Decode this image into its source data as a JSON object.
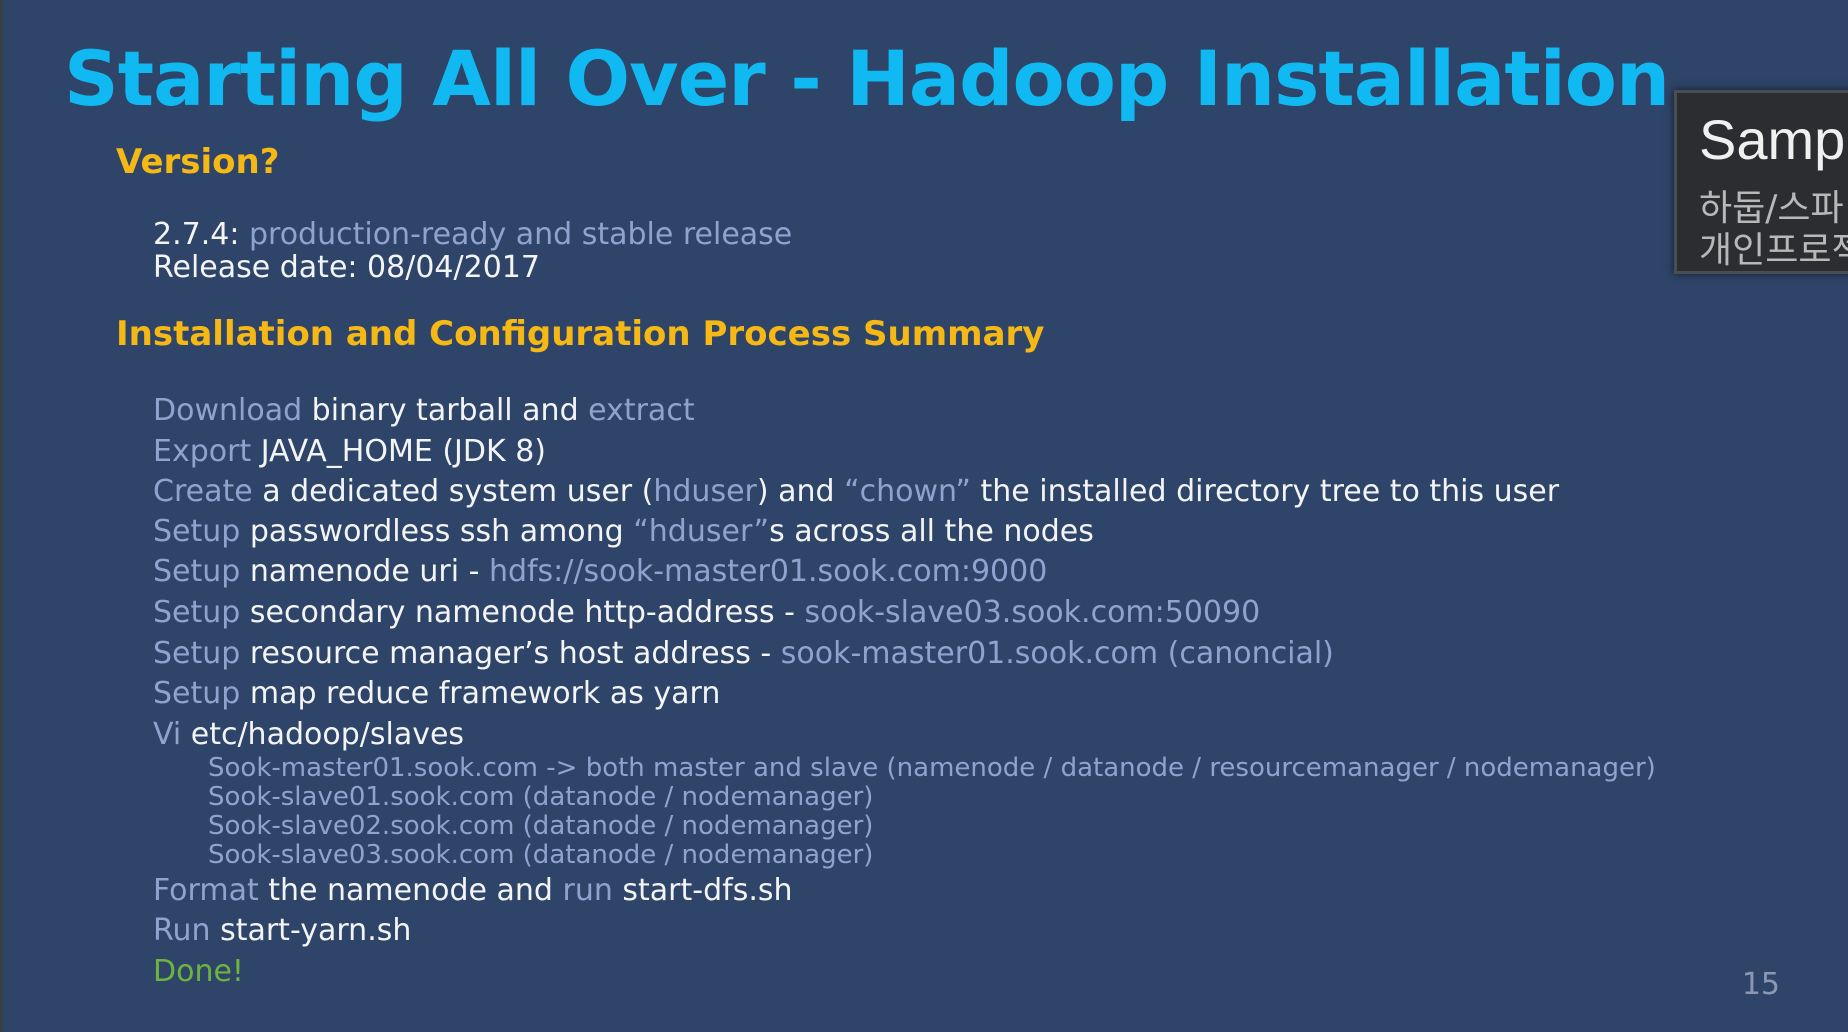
{
  "slide": {
    "title": "Starting All Over - Hadoop Installation",
    "page_number": "15"
  },
  "version": {
    "heading": "Version?",
    "number": "2.7.4: ",
    "description": "production-ready and stable release",
    "release_label": "Release date: ",
    "release_date": "08/04/2017"
  },
  "summary": {
    "heading": "Installation and Configuration Process Summary",
    "steps": {
      "download": {
        "verb": "Download",
        "text1": " binary tarball and ",
        "extract": "extract"
      },
      "export": {
        "verb": "Export",
        "text": " JAVA_HOME (JDK 8)"
      },
      "create": {
        "verb": "Create",
        "text1": " a dedicated system user (",
        "user": "hduser",
        "text2": ") and ",
        "chown": "“chown”",
        "text3": " the installed directory tree to this user"
      },
      "ssh": {
        "verb": "Setup",
        "text1": " passwordless ssh among ",
        "user": "“hduser”",
        "text2": "s across all the nodes"
      },
      "namenode": {
        "verb": "Setup",
        "text": " namenode uri - ",
        "value": "hdfs://sook-master01.sook.com:9000"
      },
      "secondary": {
        "verb": "Setup",
        "text": " secondary namenode http-address - ",
        "value": "sook-slave03.sook.com:50090"
      },
      "resource": {
        "verb": "Setup",
        "text": " resource manager’s host address - ",
        "value": "sook-master01.sook.com (canoncial)"
      },
      "mapreduce": {
        "verb": "Setup",
        "text": " map reduce framework as yarn"
      },
      "slaves": {
        "verb": "Vi",
        "text": " etc/hadoop/slaves",
        "entries": [
          "Sook-master01.sook.com  -> both master and slave (namenode / datanode / resourcemanager / nodemanager)",
          "Sook-slave01.sook.com (datanode / nodemanager)",
          "Sook-slave02.sook.com (datanode / nodemanager)",
          "Sook-slave03.sook.com (datanode / nodemanager)"
        ]
      },
      "format": {
        "verb": "Format",
        "text1": " the namenode and ",
        "run": "run",
        "text2": " start-dfs.sh"
      },
      "run_yarn": {
        "verb": "Run",
        "text": " start-yarn.sh"
      },
      "done": "Done!"
    }
  },
  "overlay": {
    "title": "Samp",
    "line1": "하둡/스파",
    "line2": "개인프로젝"
  },
  "colors": {
    "background": "#2e4468",
    "title": "#10b9f2",
    "heading": "#f5b814",
    "body_text": "#f3f4f6",
    "muted_text": "#8ea4cf",
    "done": "#6db33f"
  }
}
